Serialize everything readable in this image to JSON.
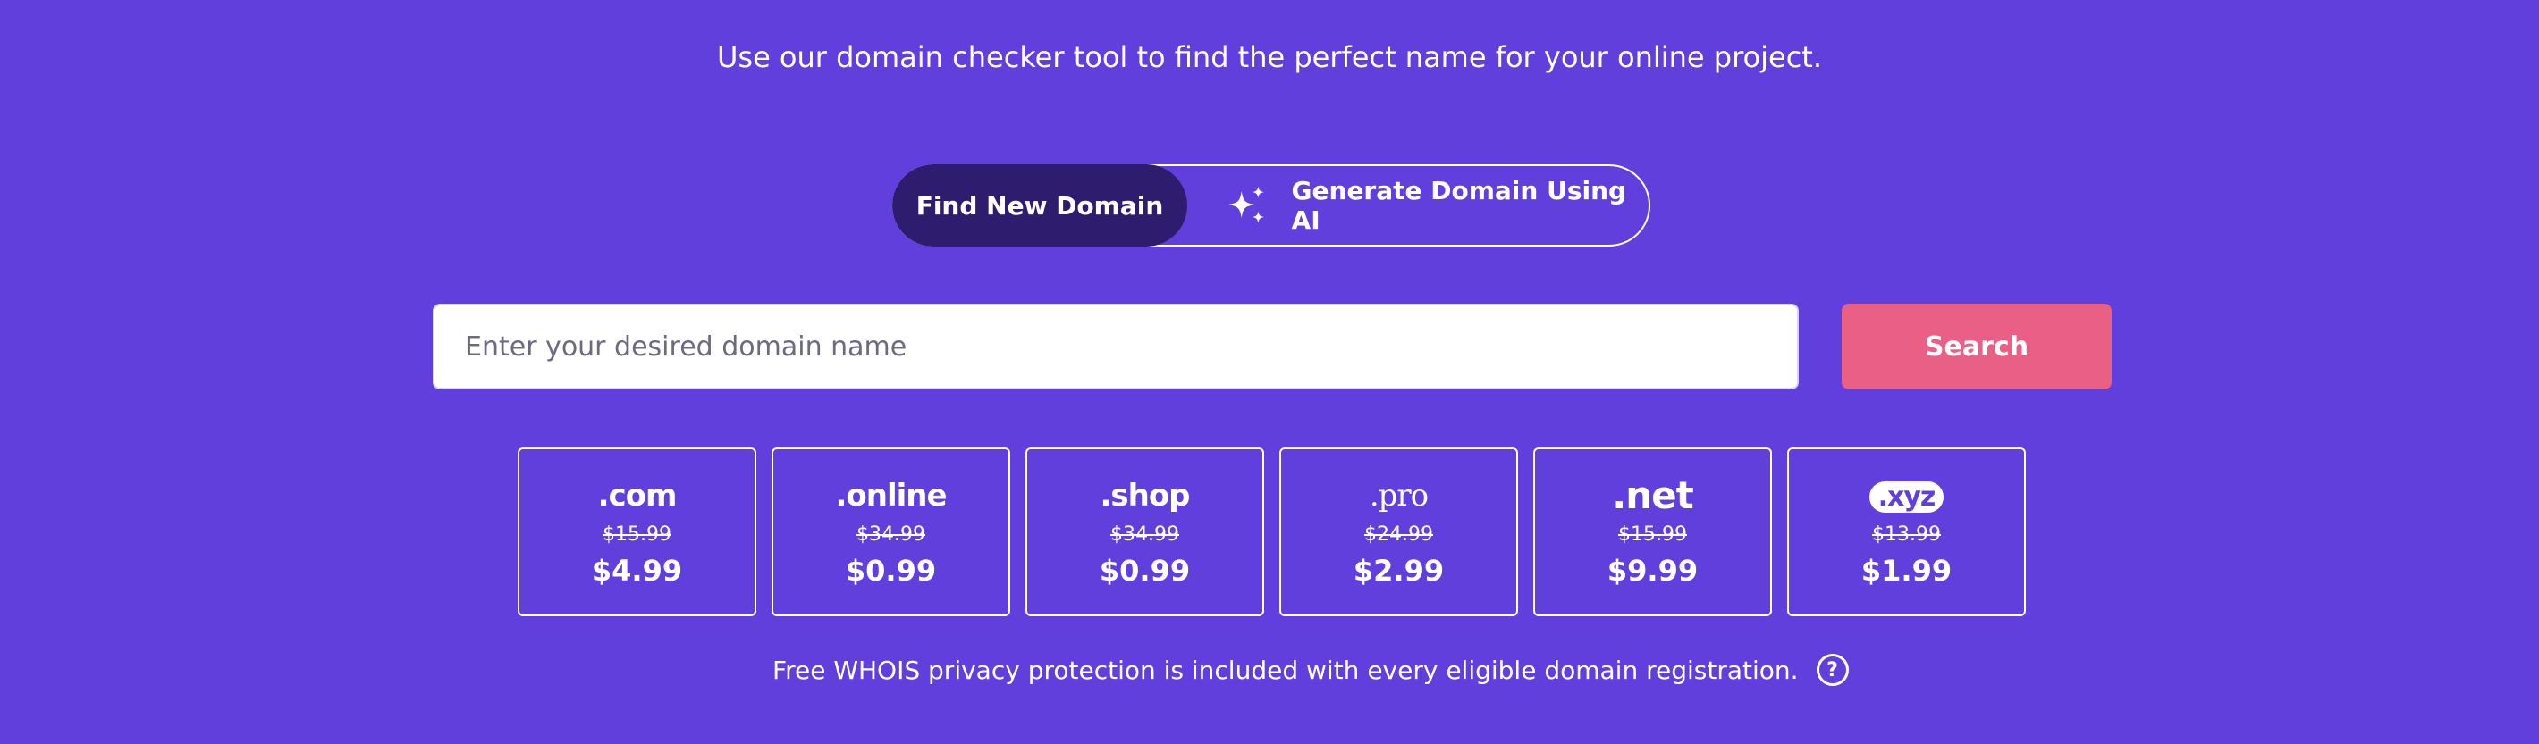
{
  "header": {
    "subtitle": "Use our domain checker tool to find the perfect name for your online project."
  },
  "toggle": {
    "find_label": "Find New Domain",
    "ai_label": "Generate Domain Using AI",
    "ai_icon": "sparkles-icon"
  },
  "search": {
    "placeholder": "Enter your desired domain name",
    "value": "",
    "button_label": "Search"
  },
  "tlds": [
    {
      "name": ".com",
      "old_price": "$15.99",
      "price": "$4.99"
    },
    {
      "name": ".online",
      "old_price": "$34.99",
      "price": "$0.99"
    },
    {
      "name": ".shop",
      "old_price": "$34.99",
      "price": "$0.99"
    },
    {
      "name": ".pro",
      "old_price": "$24.99",
      "price": "$2.99"
    },
    {
      "name": ".net",
      "old_price": "$15.99",
      "price": "$9.99"
    },
    {
      "name": ".xyz",
      "old_price": "$13.99",
      "price": "$1.99"
    }
  ],
  "footer": {
    "whois_text": "Free WHOIS privacy protection is included with every eligible domain registration.",
    "help_icon": "question-circle-icon"
  },
  "colors": {
    "background": "#613fdd",
    "toggle_active": "#2e1d6e",
    "search_button": "#e95f86"
  }
}
